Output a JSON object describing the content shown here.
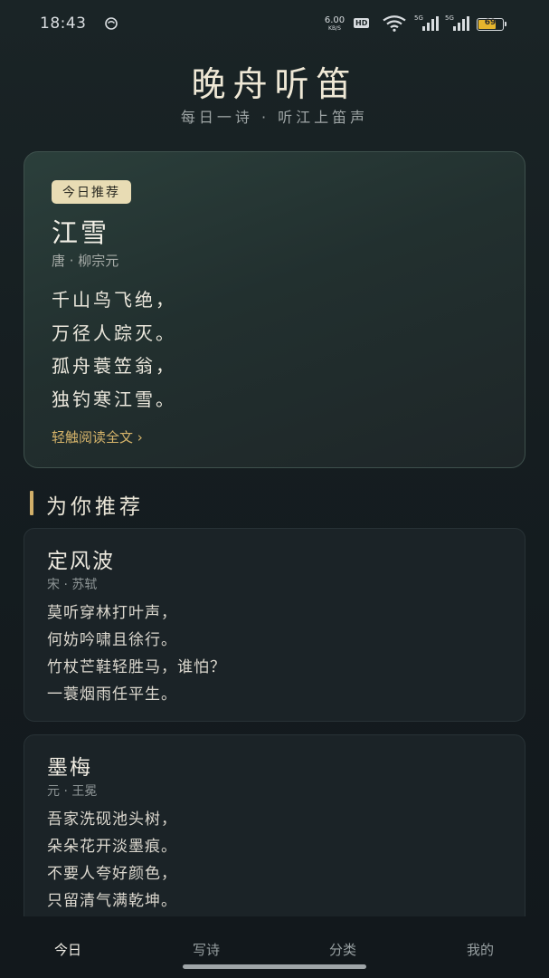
{
  "status_bar": {
    "time": "18:43",
    "net_speed_value": "6.00",
    "net_speed_unit": "KB/S",
    "hd_label": "HD",
    "signal_1_label": "5G",
    "signal_2_label": "5G",
    "battery_level": "69"
  },
  "header": {
    "title": "晚舟听笛",
    "subtitle": "每日一诗 · 听江上笛声"
  },
  "featured": {
    "badge": "今日推荐",
    "title": "江雪",
    "author": "唐 · 柳宗元",
    "lines": [
      "千山鸟飞绝，",
      "万径人踪灭。",
      "孤舟蓑笠翁，",
      "独钓寒江雪。"
    ],
    "read_more": "轻触阅读全文 ›"
  },
  "recommend": {
    "heading": "为你推荐",
    "poems": [
      {
        "title": "定风波",
        "author": "宋 · 苏轼",
        "lines": [
          "莫听穿林打叶声，",
          "何妨吟啸且徐行。",
          "竹杖芒鞋轻胜马，谁怕？",
          "一蓑烟雨任平生。"
        ]
      },
      {
        "title": "墨梅",
        "author": "元 · 王冕",
        "lines": [
          "吾家洗砚池头树，",
          "朵朵花开淡墨痕。",
          "不要人夸好颜色，",
          "只留清气满乾坤。"
        ]
      }
    ]
  },
  "nav": {
    "items": [
      "今日",
      "写诗",
      "分类",
      "我的"
    ],
    "active": "今日"
  },
  "colors": {
    "accent": "#d2b06a",
    "badge_bg": "#e8dcb4",
    "background": "#151d20"
  }
}
